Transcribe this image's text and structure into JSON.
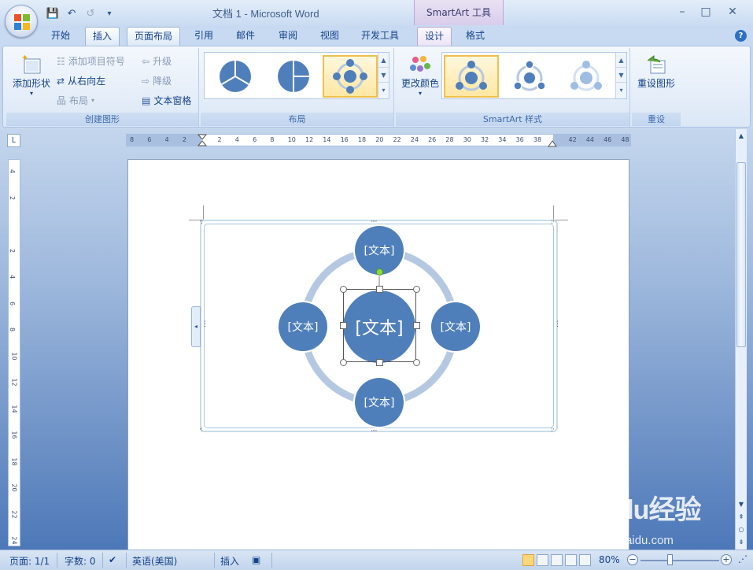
{
  "window": {
    "title": "文档 1 - Microsoft Word",
    "context_tab_group": "SmartArt 工具",
    "controls": {
      "minimize": "–",
      "maximize": "□",
      "close": "✕"
    }
  },
  "quick_access": {
    "save": "💾",
    "undo": "↶",
    "redo": "↺",
    "customize": "▾"
  },
  "tabs": [
    {
      "label": "开始",
      "active": false
    },
    {
      "label": "插入",
      "active": false
    },
    {
      "label": "页面布局",
      "active": false
    },
    {
      "label": "引用",
      "active": false
    },
    {
      "label": "邮件",
      "active": false
    },
    {
      "label": "审阅",
      "active": false
    },
    {
      "label": "视图",
      "active": false
    },
    {
      "label": "开发工具",
      "active": false
    },
    {
      "label": "设计",
      "active": true
    },
    {
      "label": "格式",
      "active": false
    }
  ],
  "ribbon": {
    "create_graphic": {
      "label": "创建图形",
      "add_shape": "添加形状",
      "add_bullet": "添加项目符号",
      "right_to_left": "从右向左",
      "layout": "布局",
      "promote": "升级",
      "demote": "降级",
      "text_pane": "文本窗格"
    },
    "layouts": {
      "label": "布局"
    },
    "styles": {
      "label": "SmartArt 样式",
      "change_colors": "更改颜色"
    },
    "reset": {
      "label": "重设",
      "reset_graphic": "重设图形"
    }
  },
  "rulers": {
    "corner": "L",
    "h_ticks": [
      "8",
      "6",
      "4",
      "2",
      "",
      "2",
      "4",
      "6",
      "8",
      "10",
      "12",
      "14",
      "16",
      "18",
      "20",
      "22",
      "24",
      "26",
      "28",
      "30",
      "32",
      "34",
      "36",
      "38",
      "",
      "42",
      "44",
      "46",
      "48"
    ],
    "v_ticks": [
      "4",
      "2",
      "",
      "2",
      "4",
      "6",
      "8",
      "10",
      "12",
      "14",
      "16",
      "18",
      "20",
      "22",
      "24"
    ]
  },
  "smartart": {
    "center": "[文本]",
    "top": "[文本]",
    "left": "[文本]",
    "right": "[文本]",
    "bottom": "[文本]"
  },
  "status": {
    "page": "页面: 1/1",
    "words": "字数: 0",
    "language": "英语(美国)",
    "mode": "插入",
    "zoom": "80%"
  },
  "watermark": {
    "brand": "Baidu经验",
    "url": "jingyan.baidu.com"
  },
  "colors": {
    "node": "#4f7fba",
    "ring": "#b5c8e1",
    "ribbon_bg": "#dbe7f6"
  }
}
